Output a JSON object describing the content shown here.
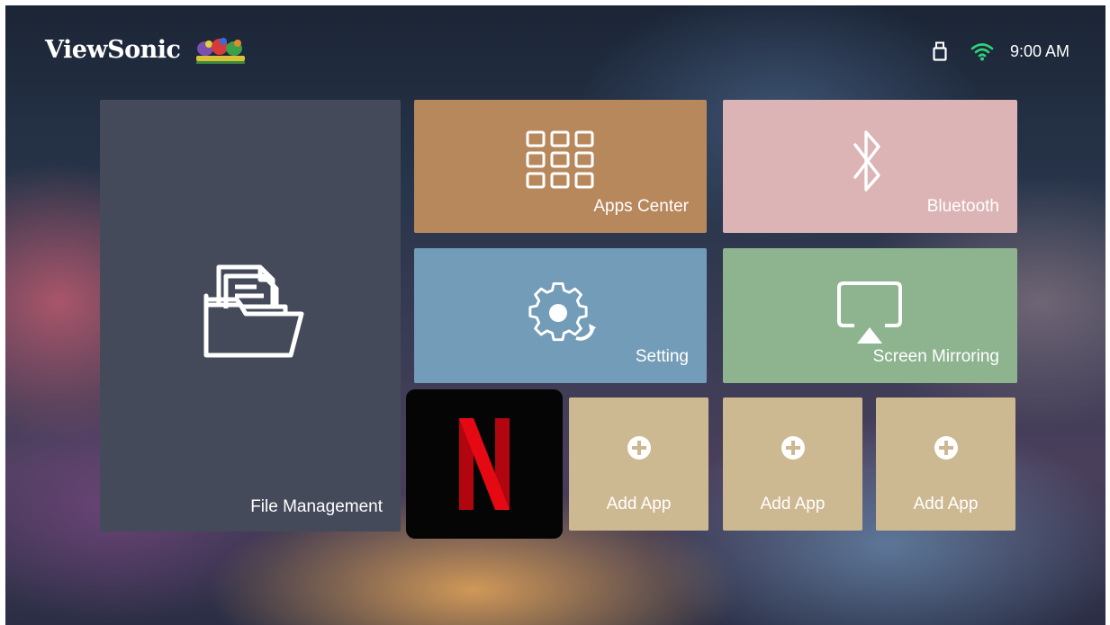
{
  "header": {
    "brand": "ViewSonic",
    "time": "9:00 AM",
    "status_icons": [
      "usb-drive-icon",
      "wifi-icon"
    ]
  },
  "tiles": {
    "file_management": {
      "label": "File Management",
      "icon": "folder-documents-icon",
      "color": "#454a5a"
    },
    "apps_center": {
      "label": "Apps Center",
      "icon": "app-grid-icon",
      "color": "#b7885c"
    },
    "bluetooth": {
      "label": "Bluetooth",
      "icon": "bluetooth-icon",
      "color": "#dcb4b6"
    },
    "setting": {
      "label": "Setting",
      "icon": "gear-icon",
      "color": "#739cb8"
    },
    "screen_mirroring": {
      "label": "Screen Mirroring",
      "icon": "screen-cast-icon",
      "color": "#8db48f"
    },
    "netflix": {
      "icon": "netflix-logo",
      "color": "#e50914"
    },
    "add_apps": [
      {
        "label": "Add App",
        "icon": "plus-circle-icon"
      },
      {
        "label": "Add App",
        "icon": "plus-circle-icon"
      },
      {
        "label": "Add App",
        "icon": "plus-circle-icon"
      }
    ]
  }
}
